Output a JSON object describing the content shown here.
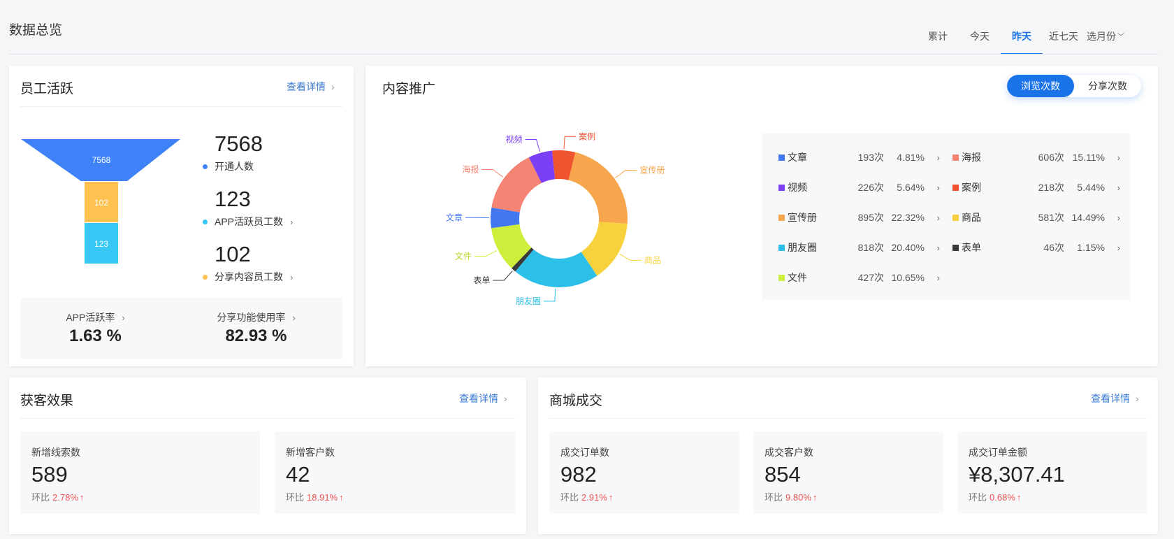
{
  "page_title": "数据总览",
  "tabs": [
    {
      "label": "累计"
    },
    {
      "label": "今天"
    },
    {
      "label": "昨天",
      "active": true
    },
    {
      "label": "近七天"
    },
    {
      "label": "选月份"
    }
  ],
  "accent_color": "#1a73e8",
  "employee": {
    "title": "员工活跃",
    "link": "查看详情",
    "funnel": {
      "top": "7568",
      "mid": "102",
      "bottom": "123",
      "colors": [
        "#3f82f7",
        "#ffc14f",
        "#38c8f5"
      ]
    },
    "metrics": [
      {
        "value": "7568",
        "label": "开通人数",
        "color": "#3f82f7"
      },
      {
        "value": "123",
        "label": "APP活跃员工数",
        "color": "#38c8f5"
      },
      {
        "value": "102",
        "label": "分享内容员工数",
        "color": "#ffc14f"
      }
    ],
    "rates": [
      {
        "label": "APP活跃率",
        "value": "1.63 %"
      },
      {
        "label": "分享功能使用率",
        "value": "82.93 %"
      }
    ]
  },
  "content": {
    "title": "内容推广",
    "toggle": [
      "浏览次数",
      "分享次数"
    ],
    "chart_data": {
      "type": "pie",
      "donut": true,
      "slices": [
        {
          "label": "宣传册",
          "value": 895,
          "color": "#f7a64d"
        },
        {
          "label": "商品",
          "value": 581,
          "color": "#f7d23e"
        },
        {
          "label": "朋友圈",
          "value": 818,
          "color": "#2cc0e8"
        },
        {
          "label": "表单",
          "value": 46,
          "color": "#3a3a3a"
        },
        {
          "label": "文件",
          "value": 427,
          "color": "#cdef3c"
        },
        {
          "label": "文章",
          "value": 193,
          "color": "#4277f0"
        },
        {
          "label": "海报",
          "value": 606,
          "color": "#f58474"
        },
        {
          "label": "视频",
          "value": 226,
          "color": "#7b3ff5"
        },
        {
          "label": "案例",
          "value": 218,
          "color": "#ee5430"
        }
      ]
    },
    "legend": [
      {
        "name": "文章",
        "count": "193次",
        "pct": "4.81%",
        "color": "#4277f0"
      },
      {
        "name": "海报",
        "count": "606次",
        "pct": "15.11%",
        "color": "#f58474"
      },
      {
        "name": "视频",
        "count": "226次",
        "pct": "5.64%",
        "color": "#7b3ff5"
      },
      {
        "name": "案例",
        "count": "218次",
        "pct": "5.44%",
        "color": "#ee5430"
      },
      {
        "name": "宣传册",
        "count": "895次",
        "pct": "22.32%",
        "color": "#f7a64d"
      },
      {
        "name": "商品",
        "count": "581次",
        "pct": "14.49%",
        "color": "#f7d23e"
      },
      {
        "name": "朋友圈",
        "count": "818次",
        "pct": "20.40%",
        "color": "#2cc0e8"
      },
      {
        "name": "表单",
        "count": "46次",
        "pct": "1.15%",
        "color": "#3a3a3a"
      },
      {
        "name": "文件",
        "count": "427次",
        "pct": "10.65%",
        "color": "#cdef3c"
      }
    ]
  },
  "acquisition": {
    "title": "获客效果",
    "link": "查看详情",
    "stats": [
      {
        "label": "新增线索数",
        "value": "589",
        "cmp": "环比",
        "pct": "2.78%"
      },
      {
        "label": "新增客户数",
        "value": "42",
        "cmp": "环比",
        "pct": "18.91%"
      }
    ]
  },
  "mall": {
    "title": "商城成交",
    "link": "查看详情",
    "stats": [
      {
        "label": "成交订单数",
        "value": "982",
        "cmp": "环比",
        "pct": "2.91%"
      },
      {
        "label": "成交客户数",
        "value": "854",
        "cmp": "环比",
        "pct": "9.80%"
      },
      {
        "label": "成交订单金额",
        "value": "¥8,307.41",
        "cmp": "环比",
        "pct": "0.68%"
      }
    ]
  }
}
